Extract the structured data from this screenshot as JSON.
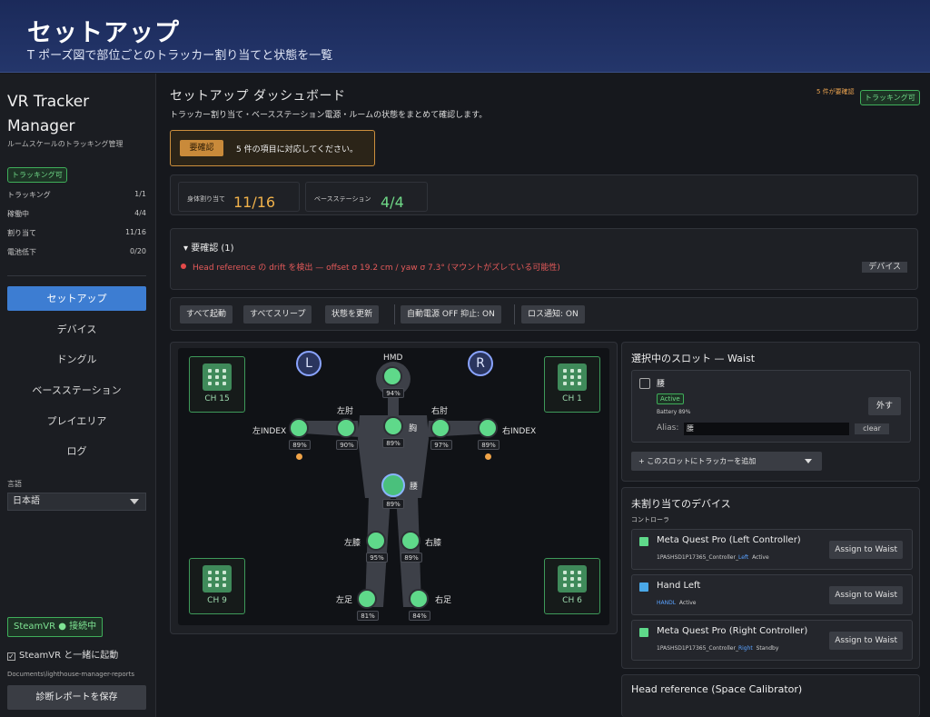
{
  "header": {
    "title": "セットアップ",
    "subtitle": "T ポーズ図で部位ごとのトラッカー割り当てと状態を一覧"
  },
  "sidebar": {
    "app_name": "VR Tracker Manager",
    "app_subtitle": "ルームスケールのトラッキング管理",
    "status_badge": "トラッキング可",
    "stats": [
      {
        "label": "トラッキング",
        "value": "1/1"
      },
      {
        "label": "稼働中",
        "value": "4/4"
      },
      {
        "label": "割り当て",
        "value": "11/16"
      },
      {
        "label": "電池低下",
        "value": "0/20"
      }
    ],
    "nav": [
      {
        "label": "セットアップ",
        "active": true
      },
      {
        "label": "デバイス",
        "active": false
      },
      {
        "label": "ドングル",
        "active": false
      },
      {
        "label": "ベースステーション",
        "active": false
      },
      {
        "label": "プレイエリア",
        "active": false
      },
      {
        "label": "ログ",
        "active": false
      }
    ],
    "language_label": "言語",
    "language_value": "日本語",
    "steamvr_badge": "SteamVR ● 接続中",
    "steamvr_autostart": "SteamVR と一緒に起動",
    "report_path": "Documents\\lighthouse-manager-reports",
    "report_button": "診断レポートを保存"
  },
  "dashboard": {
    "title": "セットアップ ダッシュボード",
    "subtitle": "トラッカー割り当て・ベースステーション電源・ルームの状態をまとめて確認します。",
    "header_warning": "5 件が要確認",
    "header_ok": "トラッキング可",
    "alert_tag": "要確認",
    "alert_message": "5 件の項目に対応してください。",
    "stat_cards": [
      {
        "label": "身体割り当て",
        "value": "11/16",
        "color": "#f0b14a"
      },
      {
        "label": "ベースステーション",
        "value": "4/4",
        "color": "#6fd887"
      }
    ],
    "issues": {
      "heading": "▾ 要確認 (1)",
      "items": [
        {
          "text": "Head reference の drift を検出 — offset σ 19.2 cm / yaw σ 7.3° (マウントがズレている可能性)",
          "action": "デバイス"
        }
      ]
    },
    "toolbar": [
      "すべて起動",
      "すべてスリープ",
      "状態を更新",
      "自動電源 OFF 抑止: ON",
      "ロス通知: ON"
    ]
  },
  "body_map": {
    "left_marker": "L",
    "right_marker": "R",
    "channels": [
      "CH 15",
      "CH 1",
      "CH 9",
      "CH 6"
    ],
    "nodes": [
      {
        "label": "HMD",
        "percent": "94%"
      },
      {
        "label": "左肘",
        "percent": "90%"
      },
      {
        "label": "右肘",
        "percent": "97%"
      },
      {
        "label": "左INDEX",
        "percent": "89%"
      },
      {
        "label": "右INDEX",
        "percent": "89%"
      },
      {
        "label": "胸",
        "percent": "89%"
      },
      {
        "label": "腰",
        "percent": "89%"
      },
      {
        "label": "左膝",
        "percent": "95%"
      },
      {
        "label": "右膝",
        "percent": "89%"
      },
      {
        "label": "左足",
        "percent": "81%"
      },
      {
        "label": "右足",
        "percent": "84%"
      }
    ]
  },
  "selected_slot": {
    "title": "選択中のスロット — Waist",
    "name": "腰",
    "status": "Active",
    "battery": "Battery 89%",
    "remove_button": "外す",
    "alias_label": "Alias:",
    "alias_value": "腰",
    "clear_button": "clear",
    "add_dropdown": "+ このスロットにトラッカーを追加"
  },
  "unassigned": {
    "title": "未割り当てのデバイス",
    "group": "コントローラ",
    "devices": [
      {
        "name": "Meta Quest Pro (Left Controller)",
        "serial": "1PASHSD1P17365_Controller_",
        "hand": "Left",
        "status": "Active",
        "color": "#5fd98a",
        "button": "Assign to Waist"
      },
      {
        "name": "Hand Left",
        "serial": "",
        "hand": "HANDL",
        "status": "Active",
        "color": "#4aa8e8",
        "button": "Assign to Waist"
      },
      {
        "name": "Meta Quest Pro (Right Controller)",
        "serial": "1PASHSD1P17365_Controller_",
        "hand": "Right",
        "status": "Standby",
        "color": "#5fd98a",
        "button": "Assign to Waist"
      }
    ]
  },
  "head_reference": {
    "title": "Head reference (Space Calibrator)"
  }
}
